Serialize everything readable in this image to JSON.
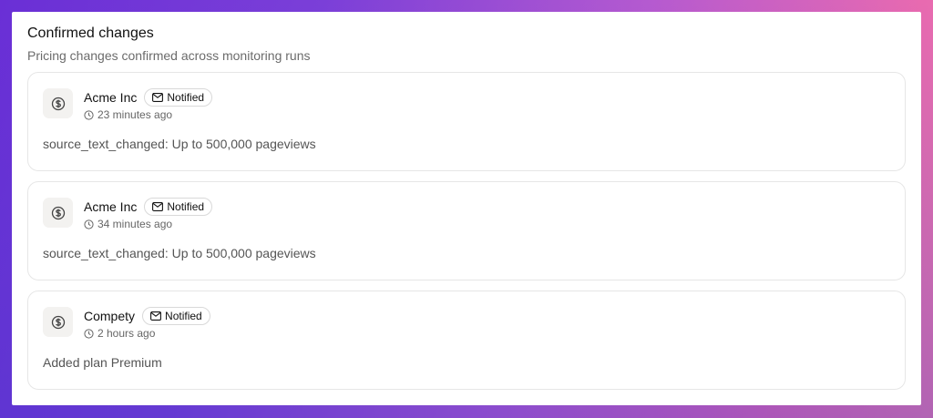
{
  "header": {
    "title": "Confirmed changes",
    "subtitle": "Pricing changes confirmed across monitoring runs"
  },
  "changes": [
    {
      "company": "Acme Inc",
      "badge": "Notified",
      "time": "23 minutes ago",
      "description": "source_text_changed: Up to 500,000 pageviews",
      "icon": "dollar-circle-icon"
    },
    {
      "company": "Acme Inc",
      "badge": "Notified",
      "time": "34 minutes ago",
      "description": "source_text_changed: Up to 500,000 pageviews",
      "icon": "dollar-circle-icon"
    },
    {
      "company": "Compety",
      "badge": "Notified",
      "time": "2 hours ago",
      "description": "Added plan Premium",
      "icon": "dollar-circle-icon"
    }
  ],
  "colors": {
    "accent_gradient_start": "#6a2fd6",
    "accent_gradient_end": "#f07fa8",
    "icon_bg": "#f3f2f0"
  }
}
